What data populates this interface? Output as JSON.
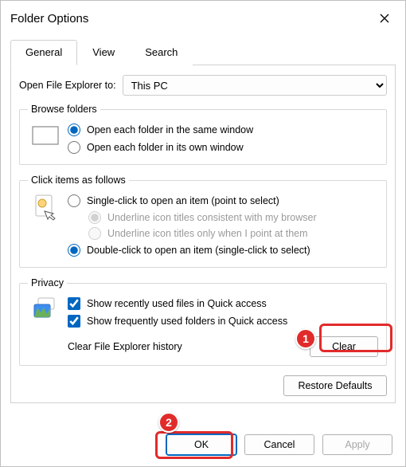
{
  "window": {
    "title": "Folder Options"
  },
  "tabs": {
    "general": "General",
    "view": "View",
    "search": "Search"
  },
  "open_to": {
    "label": "Open File Explorer to:",
    "value": "This PC"
  },
  "browse": {
    "legend": "Browse folders",
    "same": "Open each folder in the same window",
    "own": "Open each folder in its own window"
  },
  "click": {
    "legend": "Click items as follows",
    "single": "Single-click to open an item (point to select)",
    "ul_browser": "Underline icon titles consistent with my browser",
    "ul_point": "Underline icon titles only when I point at them",
    "double": "Double-click to open an item (single-click to select)"
  },
  "privacy": {
    "legend": "Privacy",
    "recent": "Show recently used files in Quick access",
    "frequent": "Show frequently used folders in Quick access",
    "clear_label": "Clear File Explorer history",
    "clear_btn": "Clear"
  },
  "restore_btn": "Restore Defaults",
  "buttons": {
    "ok": "OK",
    "cancel": "Cancel",
    "apply": "Apply"
  },
  "annotations": {
    "n1": "1",
    "n2": "2"
  }
}
